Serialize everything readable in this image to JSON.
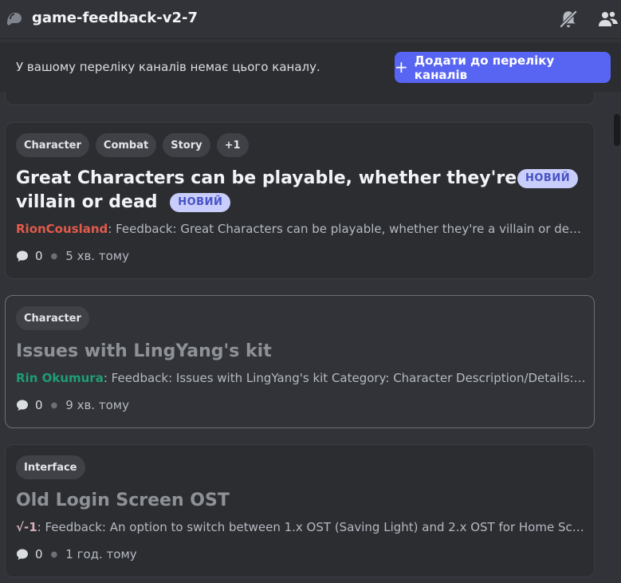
{
  "header": {
    "title": "game-feedback-v2-7",
    "icons": [
      "forum-icon",
      "mute-icon",
      "members-icon"
    ]
  },
  "banner": {
    "message": "У вашому переліку каналів немає цього каналу.",
    "button_label": "Додати до переліку каналів"
  },
  "posts": [
    {
      "tags": [
        "Character",
        "Combat",
        "Story",
        "+1"
      ],
      "title_line1": "Great Characters can be playable, whether they're a",
      "title_line2": "villain or dead",
      "new_label": "НОВИЙ",
      "author": "RionCousland",
      "author_color": "#e35a4a",
      "preview": "Feedback: Great Characters can be playable, whether they're a villain or dead...",
      "replies": "0",
      "time": "5 хв. тому"
    },
    {
      "tags": [
        "Character"
      ],
      "title": "Issues with LingYang's kit",
      "author": "Rin Okumura",
      "author_color": "#1f9e74",
      "preview": "Feedback: Issues with LingYang's kit Category: Character Description/Details: ...",
      "replies": "0",
      "time": "9 хв. тому"
    },
    {
      "tags": [
        "Interface"
      ],
      "title": "Old Login Screen OST",
      "author": "√-1",
      "author_color": "#d4b0b8",
      "preview": "Feedback: An option to switch between 1.x OST (Saving Light) and 2.x OST for Home Scr...",
      "replies": "0",
      "time": "1 год. тому"
    }
  ],
  "colors": {
    "accent": "#5865f2",
    "background": "#313338",
    "card": "#2b2d31"
  }
}
